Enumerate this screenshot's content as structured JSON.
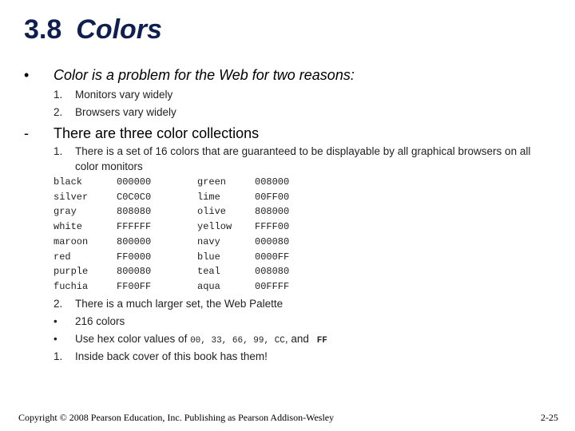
{
  "slide": {
    "title_num": "3.8",
    "title_word": "Colors",
    "bullet1": {
      "marker": "•",
      "text": "Color is a problem for the Web for two reasons:",
      "items": [
        {
          "marker": "1.",
          "text": "Monitors vary widely"
        },
        {
          "marker": "2.",
          "text": "Browsers vary widely"
        }
      ]
    },
    "bullet2": {
      "marker": "-",
      "text": "There are three color collections",
      "item1_marker": "1.",
      "item1_line1": "There is a set of 16 colors that are guaranteed to be displayable by all graphical browsers on all",
      "item1_line2": "color monitors",
      "color_table": [
        [
          "black",
          "000000",
          "green",
          "008000"
        ],
        [
          "silver",
          "C0C0C0",
          "lime",
          "00FF00"
        ],
        [
          "gray",
          "808080",
          "olive",
          "808000"
        ],
        [
          "white",
          "FFFFFF",
          "yellow",
          "FFFF00"
        ],
        [
          "maroon",
          "800000",
          "navy",
          "000080"
        ],
        [
          "red",
          "FF0000",
          "blue",
          "0000FF"
        ],
        [
          "purple",
          "800080",
          "teal",
          "008080"
        ],
        [
          "fuchia",
          "FF00FF",
          "aqua",
          "00FFFF"
        ]
      ],
      "item2_marker": "2.",
      "item2_text": "There is a much larger set, the Web Palette",
      "sub1_marker": "•",
      "sub1_text": "216 colors",
      "sub2_marker": "•",
      "sub2_prefix": "Use hex color values of ",
      "sub2_codes": "00, 33, 66, 99, CC",
      "sub2_and": ", and ",
      "sub2_last": "FF",
      "item3_marker": "1.",
      "item3_text": "Inside back cover of this book has them!"
    },
    "footer": {
      "copyright": "Copyright © 2008 Pearson Education, Inc. Publishing as Pearson Addison-Wesley",
      "page": "2-25"
    }
  }
}
